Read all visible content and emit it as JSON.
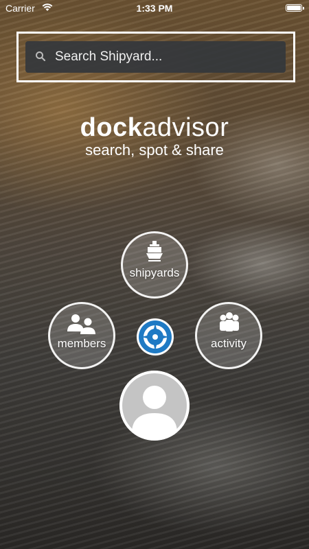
{
  "status_bar": {
    "carrier": "Carrier",
    "time": "1:33 PM"
  },
  "search": {
    "placeholder": "Search Shipyard..."
  },
  "brand": {
    "logo_bold": "dock",
    "logo_light": "advisor",
    "tagline": "search, spot & share"
  },
  "menu": {
    "shipyards_label": "shipyards",
    "members_label": "members",
    "activity_label": "activity"
  },
  "colors": {
    "search_background": "#34373c",
    "center_logo_blue": "#1f7ac4",
    "avatar_grey": "#c4c4c4"
  },
  "icons": [
    "wifi-icon",
    "battery-icon",
    "search-icon",
    "ship-icon",
    "members-icon",
    "activity-icon",
    "compass-icon",
    "avatar-icon"
  ]
}
